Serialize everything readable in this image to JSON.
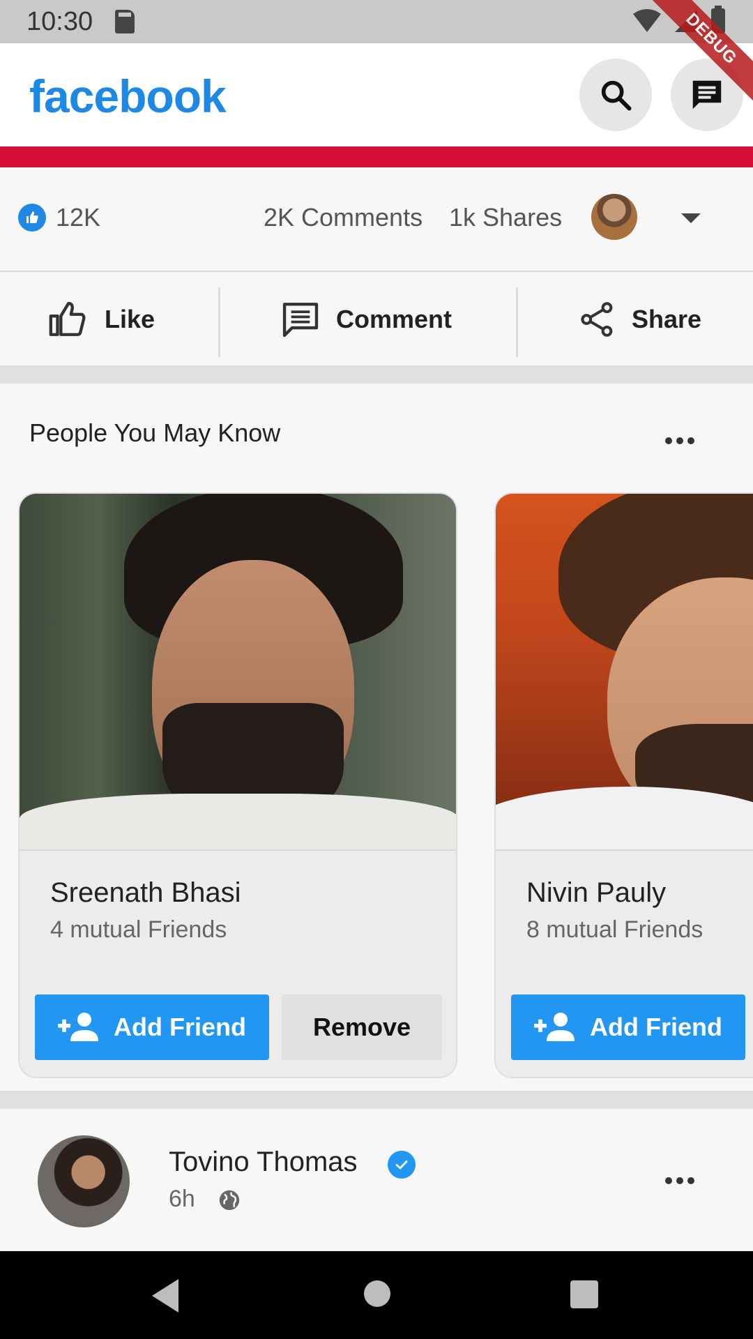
{
  "status_bar": {
    "time": "10:30",
    "debug_label": "DEBUG"
  },
  "app_bar": {
    "logo": "facebook"
  },
  "post_stats": {
    "likes": "12K",
    "comments": "2K  Comments",
    "shares": "1k  Shares"
  },
  "actions": {
    "like": "Like",
    "comment": "Comment",
    "share": "Share"
  },
  "pymk": {
    "title": "People You May Know",
    "cards": [
      {
        "name": "Sreenath Bhasi",
        "mutual": "4 mutual Friends",
        "add_label": "Add Friend",
        "remove_label": "Remove"
      },
      {
        "name": "Nivin Pauly",
        "mutual": "8 mutual Friends",
        "add_label": "Add Friend"
      }
    ]
  },
  "post": {
    "author": "Tovino Thomas",
    "time": "6h"
  },
  "colors": {
    "brand": "#1e88e5",
    "button_blue": "#2196f3",
    "red_bar": "#d50f37"
  }
}
